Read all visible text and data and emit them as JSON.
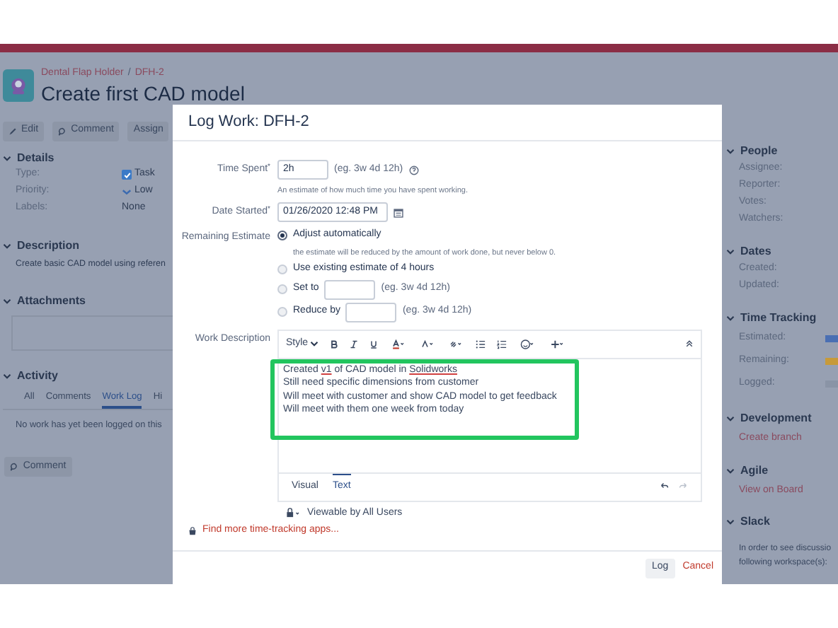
{
  "breadcrumb": {
    "project": "Dental Flap Holder",
    "separator": "/",
    "issue_key": "DFH-2"
  },
  "issue_title": "Create first CAD model",
  "toolbar": [
    {
      "kind": "edit",
      "label": "Edit"
    },
    {
      "kind": "comment",
      "label": "Comment"
    },
    {
      "kind": "plain",
      "label": "Assign"
    }
  ],
  "details": {
    "heading": "Details",
    "fields": [
      {
        "label": "Type:",
        "value": "Task",
        "kind": "task"
      },
      {
        "label": "Priority:",
        "value": "Low",
        "kind": "priority"
      },
      {
        "label": "Labels:",
        "value": "None",
        "kind": "plain"
      }
    ]
  },
  "description": {
    "heading": "Description",
    "text": "Create basic CAD model using referen"
  },
  "attachments": {
    "heading": "Attachments"
  },
  "activity": {
    "heading": "Activity",
    "tabs": [
      {
        "label": "All",
        "selected": false
      },
      {
        "label": "Comments",
        "selected": false
      },
      {
        "label": "Work Log",
        "selected": true
      },
      {
        "label": "Hi",
        "selected": false
      }
    ],
    "empty_text": "No work has yet been logged on this",
    "comment_button": "Comment"
  },
  "right_panel": [
    {
      "heading": "People",
      "kind": "fields",
      "items": [
        {
          "label": "Assignee:"
        },
        {
          "label": "Reporter:"
        },
        {
          "label": "Votes:"
        },
        {
          "label": "Watchers:"
        }
      ]
    },
    {
      "heading": "Dates",
      "kind": "fields",
      "items": [
        {
          "label": "Created:"
        },
        {
          "label": "Updated:"
        }
      ]
    },
    {
      "heading": "Time Tracking",
      "kind": "bars",
      "items": [
        {
          "label": "Estimated:",
          "color": "#4a6fb3"
        },
        {
          "label": "Remaining:",
          "color": "#c79a3a"
        },
        {
          "label": "Logged:",
          "color": "#8a94a6"
        }
      ]
    },
    {
      "heading": "Development",
      "kind": "link",
      "link": "Create branch"
    },
    {
      "heading": "Agile",
      "kind": "link",
      "link": "View on Board"
    },
    {
      "heading": "Slack",
      "kind": "text",
      "lines": [
        "In order to see discussio",
        "following workspace(s):"
      ]
    }
  ],
  "dialog": {
    "title": "Log Work: DFH-2",
    "time_spent": {
      "label": "Time Spent",
      "required_mark": "*",
      "value": "2h",
      "example": "(eg. 3w 4d 12h)",
      "hint": "An estimate of how much time you have spent working."
    },
    "date_started": {
      "label": "Date Started",
      "required_mark": "*",
      "value": "01/26/2020 12:48 PM"
    },
    "remaining_estimate": {
      "label": "Remaining Estimate",
      "options": [
        {
          "kind": "plain",
          "label": "Adjust automatically",
          "selected": true,
          "note": "the estimate will be reduced by the amount of work done, but never below 0."
        },
        {
          "kind": "plain",
          "label": "Use existing estimate of 4 hours",
          "selected": false
        },
        {
          "kind": "input",
          "label": "Set to",
          "example": "(eg. 3w 4d 12h)",
          "selected": false
        },
        {
          "kind": "input",
          "label": "Reduce by",
          "example": "(eg. 3w 4d 12h)",
          "selected": false
        }
      ]
    },
    "work_description": {
      "label": "Work Description",
      "style_menu": "Style",
      "lines": [
        [
          {
            "text": "Created ",
            "misspelled": false
          },
          {
            "text": "v1",
            "misspelled": true
          },
          {
            "text": " of CAD model in ",
            "misspelled": false
          },
          {
            "text": "Solidworks",
            "misspelled": true
          }
        ],
        [
          {
            "text": "Still need specific dimensions from customer",
            "misspelled": false
          }
        ],
        [
          {
            "text": "Will meet with customer and show CAD model to get feedback",
            "misspelled": false
          }
        ],
        [
          {
            "text": "Will meet with them one week from today",
            "misspelled": false
          }
        ]
      ],
      "editor_tabs": [
        {
          "label": "Visual",
          "selected": false
        },
        {
          "label": "Text",
          "selected": true
        }
      ],
      "visibility": "Viewable by All Users"
    },
    "apps_link": "Find more time-tracking apps...",
    "buttons": [
      {
        "kind": "primary",
        "label": "Log"
      },
      {
        "kind": "link",
        "label": "Cancel"
      }
    ]
  }
}
